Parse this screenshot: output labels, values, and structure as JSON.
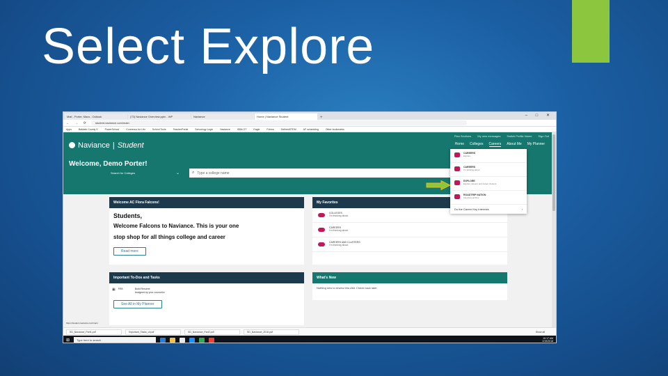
{
  "slide": {
    "title": "Select Explore",
    "accent_color": "#8cc63f"
  },
  "browser": {
    "tabs": [
      "Mail - Porter, Mara - Outlook",
      "(73) Naviance Overview.pptx - WP",
      "Naviance",
      "Home | Naviance Student"
    ],
    "active_tab_index": 3,
    "new_tab_symbol": "+",
    "controls": "– □ ✕",
    "nav_buttons": "← → ⟳",
    "url": "student.naviance.com/main",
    "bookmarks": [
      "Apps",
      "Baldwin County S",
      "PowerSchool",
      "Connexus for Libr",
      "School Tools",
      "TeacherPortal",
      "Schoology Login",
      "Naviance",
      "ISBA GT",
      "Eagle",
      "Pvhnw",
      "DefinedSTEM",
      "AF scheduling",
      "Other bookmarks"
    ]
  },
  "naviance": {
    "logo_brand": "Naviance",
    "logo_sep": "|",
    "logo_product": "Student",
    "secondary_nav": [
      "Plan Sections",
      "My new messages",
      "Switch Profile Name",
      "Sign Out"
    ],
    "nav": [
      "Home",
      "Colleges",
      "Careers",
      "About Me",
      "My Planner"
    ],
    "active_nav": "Careers",
    "welcome": "Welcome, Demo Porter!",
    "search_scope": "Search for Colleges",
    "search_placeholder": "Type a college name",
    "dropdown": {
      "items": [
        {
          "title": "CAREERS",
          "sub": "Explore"
        },
        {
          "title": "CAREERS",
          "sub": "I'm thinking about"
        },
        {
          "title": "EXPLORE",
          "sub": "Explore careers and career clusters"
        },
        {
          "title": "ROADTRIP NATION",
          "sub": "Interview archive"
        }
      ],
      "footer": "Do the Career Key Interests",
      "footer_chevron": "›"
    }
  },
  "cards": {
    "announce": {
      "head": "Welcome AC Flora Falcons!",
      "title": "Students,",
      "body_line1": "Welcome Falcons to Naviance. This is your one",
      "body_line2": "stop shop for all things college and career",
      "button": "Read more"
    },
    "favorites": {
      "head": "My Favorites",
      "items": [
        {
          "title": "COLLEGES",
          "sub": "I'm thinking about"
        },
        {
          "title": "CAREERS",
          "sub": "I'm thinking about"
        },
        {
          "title": "CAREERS AND CLUSTERS",
          "sub": "I'm thinking about"
        }
      ]
    },
    "todos": {
      "head": "Important To-Dos and Tasks",
      "date": "FEB",
      "line1": "Build Resume",
      "line2": "Assigned by your counselor",
      "button": "See All in My Planner"
    },
    "news": {
      "head": "What's New",
      "text": "Nothing new to review this visit. Check back later."
    }
  },
  "downloads": {
    "items": [
      "SD_Naviance_Part1.pdf",
      "Important_Tasks_of.pdf",
      "SD_Naviance_Part2.pdf",
      "SD_Naviance_2016.pdf"
    ],
    "show_all": "Show all",
    "status_url": "https://student.naviance.com/main"
  },
  "taskbar": {
    "start_icon": "⊞",
    "search": "Type here to search",
    "app_colors": [
      "#2d7dd2",
      "#f2c14e",
      "#e8e8e8",
      "#1e90ff",
      "#34a853",
      "#ea4335",
      "#c2185b"
    ],
    "time": "10:17 AM",
    "date": "2/19/2018"
  }
}
